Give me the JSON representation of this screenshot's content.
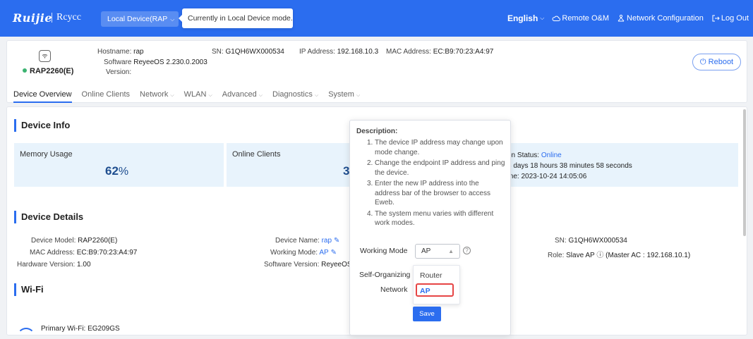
{
  "header": {
    "logo": "Ruijie",
    "logo_sub": "Rcycc",
    "mode_select": "Local Device(RAP",
    "mode_tip": "Currently in Local Device mode.",
    "language": "English",
    "remote": "Remote O&M",
    "network_config": "Network Configuration",
    "logout": "Log Out"
  },
  "device": {
    "model": "RAP2260(E)",
    "hostname_label": "Hostname:",
    "hostname": "rap",
    "software_label": "Software",
    "software": "ReyeeOS 2.230.0.2003",
    "version_label": "Version:",
    "sn_label": "SN:",
    "sn": "G1QH6WX000534",
    "ip_label": "IP Address:",
    "ip": "192.168.10.3",
    "mac_label": "MAC Address:",
    "mac": "EC:B9:70:23:A4:97",
    "reboot": "Reboot"
  },
  "tabs": [
    {
      "label": "Device Overview"
    },
    {
      "label": "Online Clients"
    },
    {
      "label": "Network"
    },
    {
      "label": "WLAN"
    },
    {
      "label": "Advanced"
    },
    {
      "label": "Diagnostics"
    },
    {
      "label": "System"
    }
  ],
  "device_info": {
    "title": "Device Info",
    "memory_label": "Memory Usage",
    "memory_value": "62",
    "memory_unit": "%",
    "clients_label": "Online Clients",
    "clients_value": "3",
    "conn_status_label": "on Status:",
    "conn_status": "Online",
    "uptime": "3 days 18 hours 38 minutes 58 seconds",
    "time_label": "me:",
    "time": "2023-10-24 14:05:06"
  },
  "device_details": {
    "title": "Device Details",
    "model_label": "Device Model:",
    "model": "RAP2260(E)",
    "mac_label": "MAC Address:",
    "mac": "EC:B9:70:23:A4:97",
    "hw_label": "Hardware Version:",
    "hw": "1.00",
    "name_label": "Device Name:",
    "name": "rap",
    "wm_label": "Working Mode:",
    "wm": "AP",
    "sw_label": "Software Version:",
    "sw": "ReyeeOS",
    "sn_label": "SN:",
    "sn": "G1QH6WX000534",
    "role_label": "Role:",
    "role": "Slave AP",
    "master_ac": "(Master AC : 192.168.10.1)"
  },
  "wifi": {
    "title": "Wi-Fi",
    "primary": "Primary Wi-Fi: EG209GS"
  },
  "popover": {
    "title": "Description:",
    "items": [
      "The device IP address may change upon mode change.",
      "Change the endpoint IP address and ping the device.",
      "Enter the new IP address into the address bar of the browser to access Eweb.",
      "The system menu varies with different work modes."
    ],
    "working_mode_label": "Working Mode",
    "working_mode_value": "AP",
    "self_org_label": "Self-Organizing",
    "network_label": "Network",
    "options": [
      "Router",
      "AP"
    ],
    "save": "Save"
  },
  "colors": {
    "primary": "#2b6def",
    "online_dot": "#3cb371",
    "highlight": "#e64545"
  }
}
